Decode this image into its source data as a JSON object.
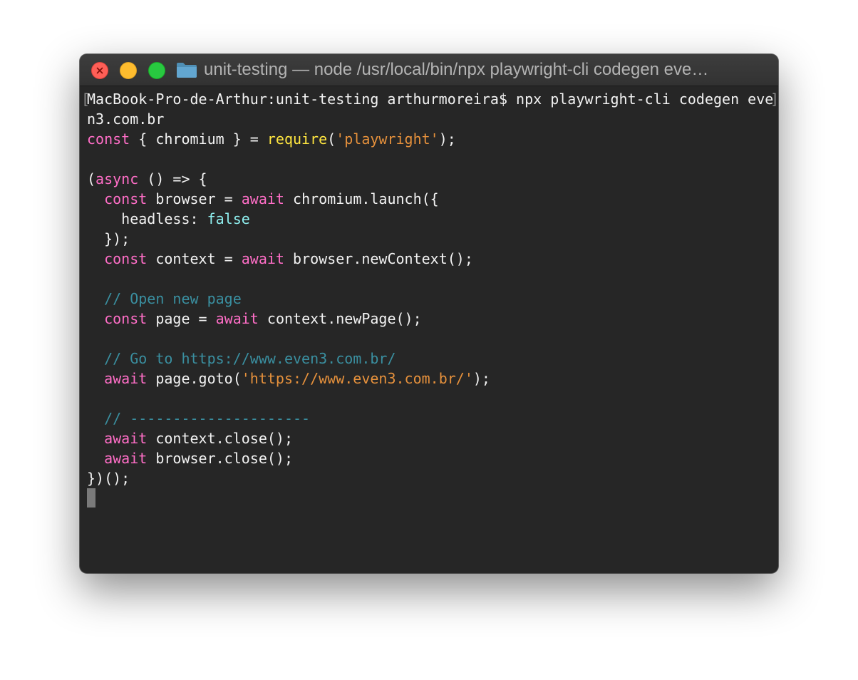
{
  "window": {
    "title": "unit-testing — node /usr/local/bin/npx playwright-cli codegen eve…",
    "folder_icon": "folder-icon",
    "controls": [
      "close",
      "minimize",
      "zoom"
    ]
  },
  "colors": {
    "background": "#262626",
    "text": "#f2f2f2",
    "keyword": "#ff6ec7",
    "function": "#ffe640",
    "string": "#e6913c",
    "boolean": "#8ff0f0",
    "comment": "#3a8fa0"
  },
  "terminal": {
    "prompt_bracket_open": "[",
    "prompt_bracket_close": "]",
    "prompt": "MacBook-Pro-de-Arthur:unit-testing arthurmoreira$ npx playwright-cli codegen eve",
    "prompt_wrap": "n3.com.br",
    "code": {
      "l1": {
        "kw": "const",
        "a": " { chromium } = ",
        "fn": "require",
        "b": "(",
        "str": "'playwright'",
        "c": ");"
      },
      "l3": {
        "a": "(",
        "kw": "async",
        "b": " () => {"
      },
      "l4": {
        "pre": "  ",
        "kw": "const",
        "a": " browser = ",
        "kw2": "await",
        "b": " chromium.launch({"
      },
      "l5": {
        "a": "    headless: ",
        "bool": "false"
      },
      "l6": {
        "a": "  });"
      },
      "l7": {
        "pre": "  ",
        "kw": "const",
        "a": " context = ",
        "kw2": "await",
        "b": " browser.newContext();"
      },
      "l9": {
        "cm": "  // Open new page"
      },
      "l10": {
        "pre": "  ",
        "kw": "const",
        "a": " page = ",
        "kw2": "await",
        "b": " context.newPage();"
      },
      "l12": {
        "cm": "  // Go to https://www.even3.com.br/"
      },
      "l13": {
        "pre": "  ",
        "kw": "await",
        "a": " page.goto(",
        "str": "'https://www.even3.com.br/'",
        "b": ");"
      },
      "l15": {
        "cm": "  // ---------------------"
      },
      "l16": {
        "pre": "  ",
        "kw": "await",
        "a": " context.close();"
      },
      "l17": {
        "pre": "  ",
        "kw": "await",
        "a": " browser.close();"
      },
      "l18": {
        "a": "})();"
      }
    }
  }
}
